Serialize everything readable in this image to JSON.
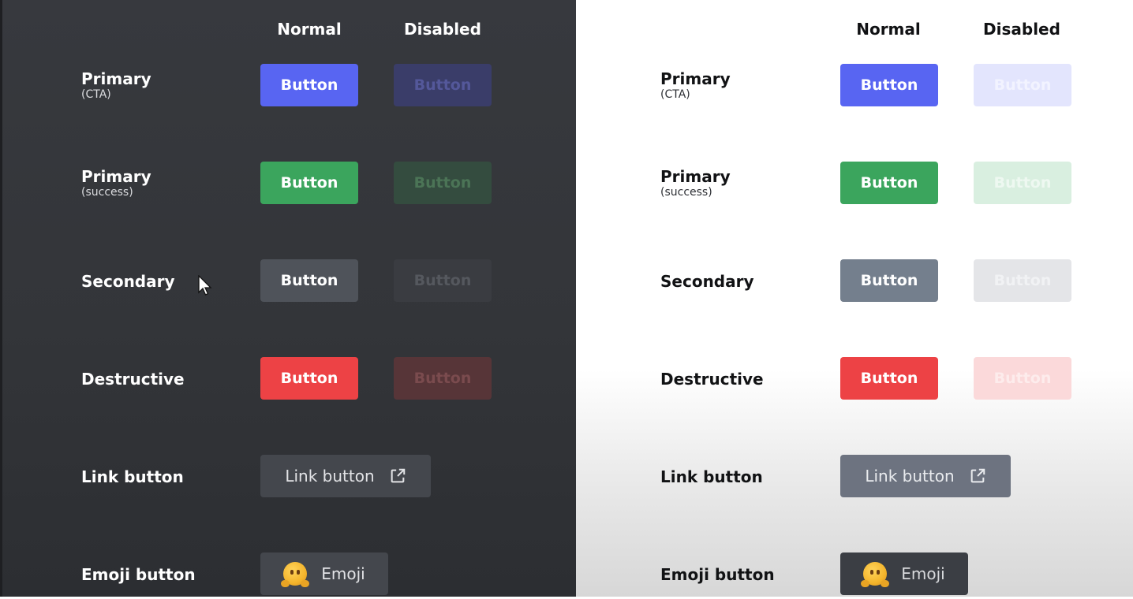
{
  "columns": {
    "normal": "Normal",
    "disabled": "Disabled"
  },
  "rows": {
    "primary_cta": {
      "label": "Primary",
      "sub": "(CTA)",
      "button": "Button",
      "disabled_button": "Button"
    },
    "primary_success": {
      "label": "Primary",
      "sub": "(success)",
      "button": "Button",
      "disabled_button": "Button"
    },
    "secondary": {
      "label": "Secondary",
      "button": "Button",
      "disabled_button": "Button"
    },
    "destructive": {
      "label": "Destructive",
      "button": "Button",
      "disabled_button": "Button"
    },
    "link": {
      "label": "Link button",
      "button": "Link button",
      "icon": "external-link-icon"
    },
    "emoji": {
      "label": "Emoji button",
      "button": "Emoji",
      "icon": "hugging-face-emoji-icon"
    }
  },
  "colors": {
    "blurple": "#5865f2",
    "success": "#3ba55d",
    "secondary_dark": "#4f535a",
    "secondary_light": "#747f8d",
    "destructive": "#ed4245",
    "dark_background": "#36393f",
    "light_background": "#ffffff"
  },
  "themes": [
    "dark",
    "light"
  ]
}
